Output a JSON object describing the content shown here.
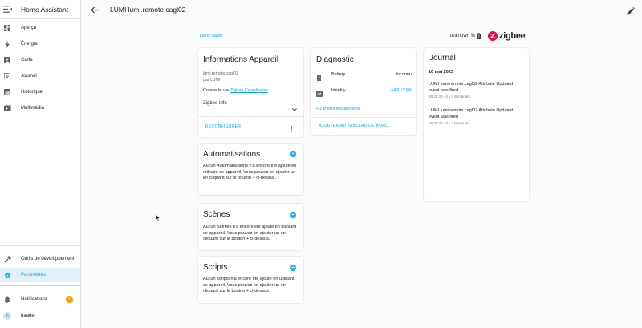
{
  "sidebar": {
    "title": "Home Assistant",
    "items": [
      {
        "label": "Aperçu",
        "icon": "dashboard-icon"
      },
      {
        "label": "Énergie",
        "icon": "lightning-icon"
      },
      {
        "label": "Carte",
        "icon": "map-icon"
      },
      {
        "label": "Journal",
        "icon": "list-icon"
      },
      {
        "label": "Historique",
        "icon": "chart-icon"
      },
      {
        "label": "Multimédia",
        "icon": "media-icon"
      }
    ],
    "bottom_items": [
      {
        "label": "Outils de développement",
        "icon": "hammer-icon"
      },
      {
        "label": "Paramètres",
        "icon": "gear-icon"
      }
    ],
    "notifications": {
      "label": "Notifications",
      "count": "1"
    },
    "user": {
      "initial": "h",
      "name": "haade"
    }
  },
  "topbar": {
    "title": "LUMI lumi.remote.cagl02"
  },
  "area_link": "Dans Salon",
  "status": {
    "battery_text": "unknown %",
    "brand": "zigbee"
  },
  "device_info": {
    "title": "Informations Appareil",
    "model": "lumi.remote.cagl02",
    "manufacturer": "par LUMI",
    "connected_prefix": "Connecté via",
    "connected_link": "Zigbee Coordinator",
    "zigbee_info": "Zigbee info",
    "reconfigure": "RECONFIGURER"
  },
  "automations": {
    "title": "Automatisations",
    "text": "Aucun Automatisations n'a encore été ajouté en utilisant ce appareil. Vous pouvez en ajouter un en cliquant sur le bouton + ci-dessus."
  },
  "scenes": {
    "title": "Scènes",
    "text": "Aucun Scènes n'a encore été ajouté en utilisant ce appareil. Vous pouvez en ajouter un en cliquant sur le bouton + ci-dessus."
  },
  "scripts": {
    "title": "Scripts",
    "text": "Aucun scripts n'a encore été ajouté en utilisant ce appareil. Vous pouvez en ajouter un en cliquant sur le bouton + ci-dessus."
  },
  "diagnostic": {
    "title": "Diagnostic",
    "rows": [
      {
        "label": "Battery",
        "value": "Inconnu"
      },
      {
        "label": "Identify",
        "value": "APPUYER"
      }
    ],
    "hidden": "+ 2 entités non affichées",
    "add_dashboard": "AJOUTER AU TABLEAU DE BORD"
  },
  "journal": {
    "title": "Journal",
    "date": "16 mai 2023",
    "entries": [
      {
        "text": "LUMI lumi.remote.cagl02 Attribute Updated event was fired",
        "time": "15:26:30 - Il y a 8 minutes"
      },
      {
        "text": "LUMI lumi.remote.cagl02 Attribute Updated event was fired",
        "time": "15:25:26 - Il y a 8 minutes"
      }
    ]
  },
  "colors": {
    "accent": "#03a9f4",
    "badge": "#ff9800",
    "zigbee": "#eb0443"
  }
}
